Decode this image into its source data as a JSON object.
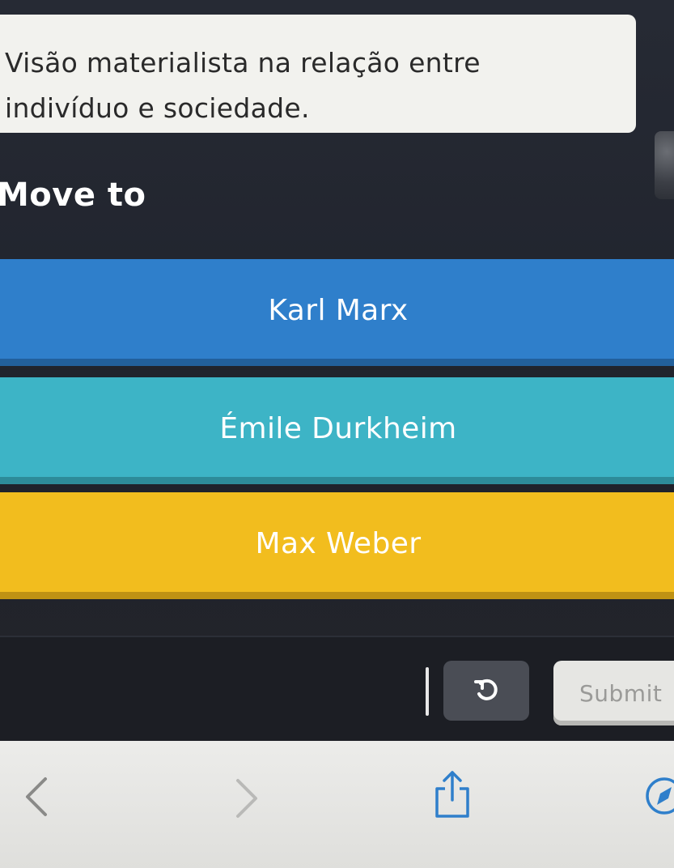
{
  "question": {
    "line1": "Visão materialista na relação entre",
    "line2": "indivíduo e sociedade."
  },
  "move_to_label": "Move to",
  "choices": [
    {
      "label": "Karl Marx",
      "color": "#2f7fcb"
    },
    {
      "label": "Émile Durkheim",
      "color": "#3db4c6"
    },
    {
      "label": "Max Weber",
      "color": "#f2bd1e"
    }
  ],
  "toolbar": {
    "undo_icon": "undo-icon",
    "submit_label": "Submit"
  },
  "browser": {
    "icons": [
      "back-icon",
      "forward-icon",
      "share-icon",
      "safari-icon"
    ]
  }
}
